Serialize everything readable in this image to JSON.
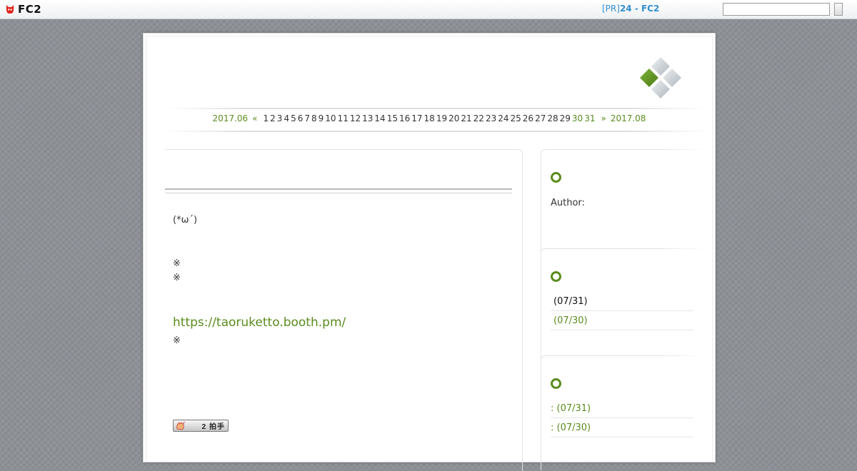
{
  "fc2bar": {
    "logo_text": "FC2",
    "pr_tag": "[PR]",
    "pr_text": "24 - FC2",
    "search_placeholder": ""
  },
  "calendar": {
    "prev_month": "2017.06",
    "prev_arrow": "«",
    "days": [
      "1",
      "2",
      "3",
      "4",
      "5",
      "6",
      "7",
      "8",
      "9",
      "10",
      "11",
      "12",
      "13",
      "14",
      "15",
      "16",
      "17",
      "18",
      "19",
      "20",
      "21",
      "22",
      "23",
      "24",
      "25",
      "26",
      "27",
      "28",
      "29",
      "30",
      "31"
    ],
    "linked_days": [
      "30",
      "31"
    ],
    "next_arrow": "»",
    "next_month": "2017.08"
  },
  "entry": {
    "face": "(*ω´)",
    "mark1": "※",
    "mark2": "※",
    "link": "https://taoruketto.booth.pm/",
    "mark3": "※",
    "clap_count": "2 拍手"
  },
  "sidebar": {
    "profile": {
      "author_label": "Author:"
    },
    "recent_entries": [
      {
        "label": "(07/31)"
      },
      {
        "label": "(07/30)"
      }
    ],
    "recent_comments": [
      {
        "label": ": (07/31)"
      },
      {
        "label": ": (07/30)"
      }
    ]
  },
  "colors": {
    "accent_green": "#5b8c1e",
    "pr_blue": "#2f8fd0",
    "background": "#8d9096"
  }
}
